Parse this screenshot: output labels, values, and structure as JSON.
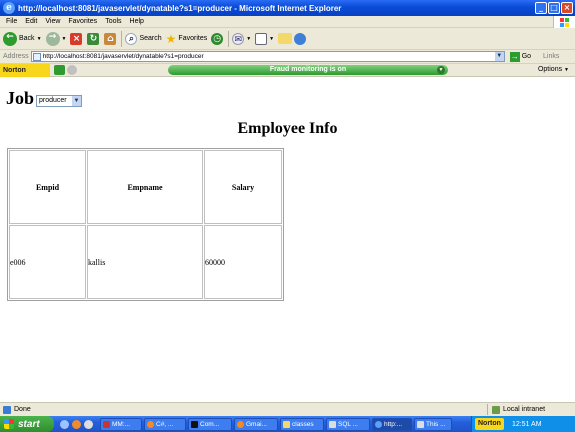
{
  "window": {
    "title": "http://localhost:8081/javaservlet/dynatable?s1=producer - Microsoft Internet Explorer",
    "controls": {
      "minimize": "_",
      "maximize": "□",
      "close": "×"
    }
  },
  "menubar": {
    "items": [
      "File",
      "Edit",
      "View",
      "Favorites",
      "Tools",
      "Help"
    ]
  },
  "toolbar": {
    "back": "Back",
    "search": "Search",
    "favorites": "Favorites"
  },
  "addressbar": {
    "label": "Address",
    "url": "http://localhost:8081/javaservlet/dynatable?s1=producer",
    "go": "Go",
    "links": "Links"
  },
  "nortonbar": {
    "logo": "Norton",
    "fraud_status": "Fraud monitoring is on",
    "options": "Options"
  },
  "page": {
    "job_label": "Job",
    "job_selected": "producer",
    "heading": "Employee Info",
    "table": {
      "headers": [
        "Empid",
        "Empname",
        "Salary"
      ],
      "rows": [
        [
          "e006",
          "kallis",
          "60000"
        ]
      ]
    }
  },
  "statusbar": {
    "status": "Done",
    "zone": "Local intranet"
  },
  "taskbar": {
    "start": "start",
    "tasks": [
      "MM:...",
      "C#, ...",
      "Com...",
      "Gmai...",
      "classes",
      "SQL ...",
      "http:...",
      "This ..."
    ],
    "tray_norton": "Norton",
    "clock": "12:51 AM"
  },
  "colors": {
    "xp_blue": "#0a4bd6",
    "norton_yellow": "#f7d61c",
    "fraud_green": "#2f9a2f"
  }
}
